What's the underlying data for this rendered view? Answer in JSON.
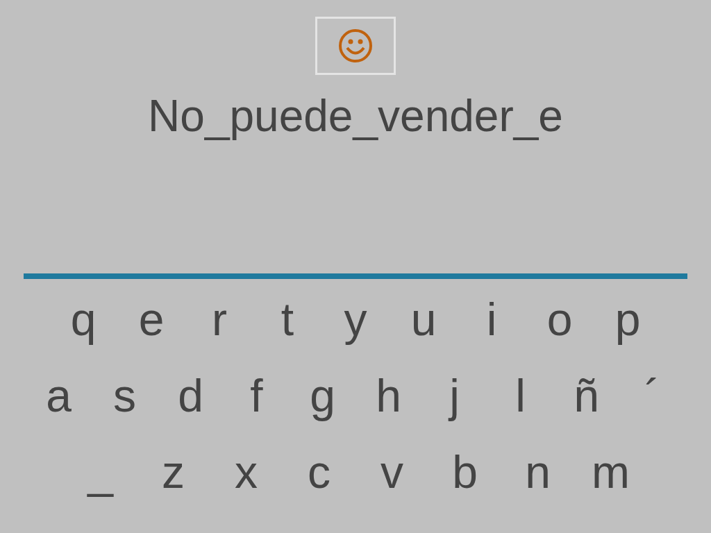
{
  "answer": "No_puede_vender_e",
  "keyboard": [
    [
      "q",
      "e",
      "r",
      "t",
      "y",
      "u",
      "i",
      "o",
      "p"
    ],
    [
      "a",
      "s",
      "d",
      "f",
      "g",
      "h",
      "j",
      "l",
      "ñ",
      "´"
    ],
    [
      "_",
      "z",
      "x",
      "c",
      "v",
      "b",
      "n",
      "m"
    ]
  ]
}
